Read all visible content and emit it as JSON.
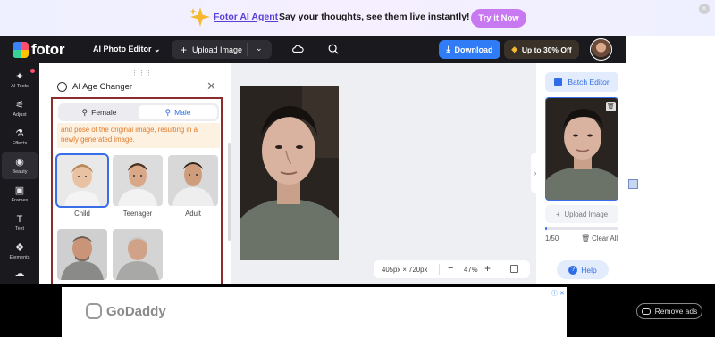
{
  "banner": {
    "agent_label": "Fotor AI Agent",
    "tagline": "Say your thoughts, see them live instantly!",
    "cta": "Try it Now",
    "close": "×"
  },
  "nav": {
    "logo": "fotor",
    "editor_menu": "AI Photo Editor",
    "upload_label": "Upload Image",
    "download_label": "Download",
    "offer_label": "Up to 30% Off"
  },
  "tools": [
    {
      "label": "AI Tools",
      "icon": "sparkle-icon",
      "glyph": "✦"
    },
    {
      "label": "Adjust",
      "icon": "sliders-icon",
      "glyph": "⚟"
    },
    {
      "label": "Effects",
      "icon": "flask-icon",
      "glyph": "⚗"
    },
    {
      "label": "Beauty",
      "icon": "eye-icon",
      "glyph": "◉"
    },
    {
      "label": "Frames",
      "icon": "frame-icon",
      "glyph": "▣"
    },
    {
      "label": "Text",
      "icon": "text-icon",
      "glyph": "T"
    },
    {
      "label": "Elements",
      "icon": "elements-icon",
      "glyph": "❖"
    }
  ],
  "panel": {
    "title": "AI Age Changer",
    "gender_female": "Female",
    "gender_male": "Male",
    "note_line1": "and pose of the original image, resulting in a",
    "note_line2": "newly generated image.",
    "ages": [
      {
        "label": "Child"
      },
      {
        "label": "Teenager"
      },
      {
        "label": "Adult"
      },
      {
        "label": ""
      },
      {
        "label": ""
      }
    ],
    "selected_age": "Child",
    "selected_gender": "Male"
  },
  "canvas": {
    "dimensions": "405px × 720px",
    "zoom": "47%",
    "zoom_minus": "−",
    "zoom_plus": "+"
  },
  "right_panel": {
    "batch_label": "Batch Editor",
    "upload_label": "Upload Image",
    "count": "1/50",
    "progress": 0.02,
    "clear_label": "Clear All",
    "help_label": "Help"
  },
  "ad": {
    "brand": "GoDaddy",
    "remove_label": "Remove ads"
  },
  "colors": {
    "accent": "#2f7cf6",
    "highlight_box": "#8c2c2c",
    "note_text": "#e07a2a"
  }
}
